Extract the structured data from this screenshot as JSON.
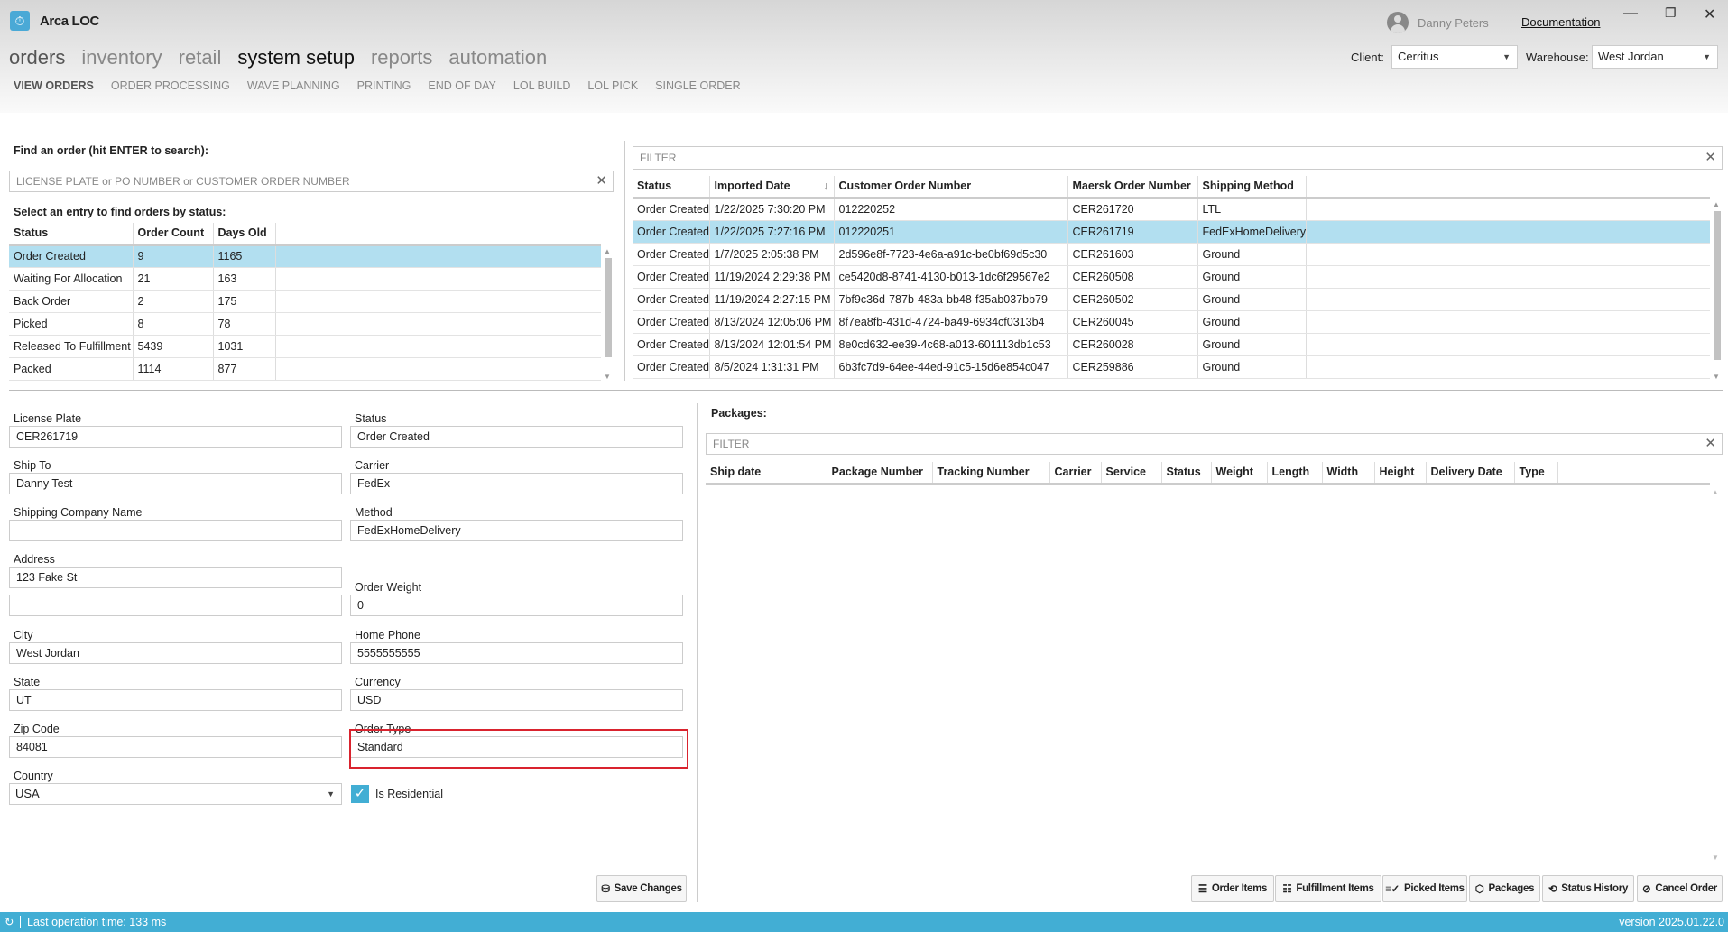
{
  "app": {
    "title": "Arca LOC",
    "user": "Danny Peters",
    "documentation": "Documentation"
  },
  "nav": [
    "orders",
    "inventory",
    "retail",
    "system setup",
    "reports",
    "automation"
  ],
  "subnav": [
    "VIEW ORDERS",
    "ORDER PROCESSING",
    "WAVE PLANNING",
    "PRINTING",
    "END OF DAY",
    "LOL BUILD",
    "LOL PICK",
    "SINGLE ORDER"
  ],
  "client": {
    "label": "Client:",
    "value": "Cerritus"
  },
  "warehouse": {
    "label": "Warehouse:",
    "value": "West Jordan"
  },
  "search": {
    "label": "Find an order (hit ENTER to search):",
    "placeholder": "LICENSE PLATE or PO NUMBER or CUSTOMER ORDER NUMBER",
    "status_label": "Select an entry to find orders by status:"
  },
  "status_table": {
    "columns": [
      "Status",
      "Order Count",
      "Days Old"
    ],
    "rows": [
      [
        "Order Created",
        "9",
        "1165"
      ],
      [
        "Waiting For Allocation",
        "21",
        "163"
      ],
      [
        "Back Order",
        "2",
        "175"
      ],
      [
        "Picked",
        "8",
        "78"
      ],
      [
        "Released To Fulfillment",
        "5439",
        "1031"
      ],
      [
        "Packed",
        "1114",
        "877"
      ]
    ],
    "selected": 0
  },
  "orders": {
    "filter_placeholder": "FILTER",
    "columns": [
      "Status",
      "Imported Date",
      "Customer Order Number",
      "Maersk Order Number",
      "Shipping Method"
    ],
    "sort_column": "Imported Date",
    "rows": [
      [
        "Order Created",
        "1/22/2025 7:30:20 PM",
        "012220252",
        "CER261720",
        "LTL"
      ],
      [
        "Order Created",
        "1/22/2025 7:27:16 PM",
        "012220251",
        "CER261719",
        "FedExHomeDelivery"
      ],
      [
        "Order Created",
        "1/7/2025 2:05:38 PM",
        "2d596e8f-7723-4e6a-a91c-be0bf69d5c30",
        "CER261603",
        "Ground"
      ],
      [
        "Order Created",
        "11/19/2024 2:29:38 PM",
        "ce5420d8-8741-4130-b013-1dc6f29567e2",
        "CER260508",
        "Ground"
      ],
      [
        "Order Created",
        "11/19/2024 2:27:15 PM",
        "7bf9c36d-787b-483a-bb48-f35ab037bb79",
        "CER260502",
        "Ground"
      ],
      [
        "Order Created",
        "8/13/2024 12:05:06 PM",
        "8f7ea8fb-431d-4724-ba49-6934cf0313b4",
        "CER260045",
        "Ground"
      ],
      [
        "Order Created",
        "8/13/2024 12:01:54 PM",
        "8e0cd632-ee39-4c68-a013-601113db1c53",
        "CER260028",
        "Ground"
      ],
      [
        "Order Created",
        "8/5/2024 1:31:31 PM",
        "6b3fc7d9-64ee-44ed-91c5-15d6e854c047",
        "CER259886",
        "Ground"
      ]
    ],
    "selected": 1
  },
  "form": {
    "license_plate": {
      "label": "License Plate",
      "value": "CER261719"
    },
    "ship_to": {
      "label": "Ship To",
      "value": "Danny Test"
    },
    "shipping_company": {
      "label": "Shipping Company Name",
      "value": ""
    },
    "address": {
      "label": "Address",
      "value": "123 Fake St",
      "value2": ""
    },
    "city": {
      "label": "City",
      "value": "West Jordan"
    },
    "state": {
      "label": "State",
      "value": "UT"
    },
    "zip": {
      "label": "Zip Code",
      "value": "84081"
    },
    "country": {
      "label": "Country",
      "value": "USA"
    },
    "status": {
      "label": "Status",
      "value": "Order Created"
    },
    "carrier": {
      "label": "Carrier",
      "value": "FedEx"
    },
    "method": {
      "label": "Method",
      "value": "FedExHomeDelivery"
    },
    "order_weight": {
      "label": "Order Weight",
      "value": "0"
    },
    "home_phone": {
      "label": "Home Phone",
      "value": "5555555555"
    },
    "currency": {
      "label": "Currency",
      "value": "USD"
    },
    "order_type": {
      "label": "Order Type",
      "value": "Standard"
    },
    "is_residential": {
      "label": "Is Residential",
      "checked": true
    },
    "save_label": "Save Changes"
  },
  "packages": {
    "title": "Packages:",
    "filter_placeholder": "FILTER",
    "columns": [
      "Ship date",
      "Package Number",
      "Tracking Number",
      "Carrier",
      "Service",
      "Status",
      "Weight",
      "Length",
      "Width",
      "Height",
      "Delivery Date",
      "Type"
    ],
    "rows": []
  },
  "actions": [
    "Order Items",
    "Fulfillment Items",
    "Picked Items",
    "Packages",
    "Status History",
    "Cancel Order"
  ],
  "statusbar": {
    "last_op": "Last operation time:  133 ms",
    "version": "version 2025.01.22.0"
  },
  "colors": {
    "accent": "#42aed4",
    "selected_row": "#b2dff0",
    "highlight": "#d9232e"
  }
}
